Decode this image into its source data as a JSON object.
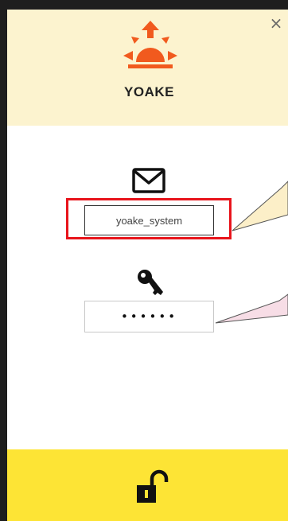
{
  "app": {
    "name": "YOAKE",
    "logo_icon": "sunrise-icon",
    "brand_color": "#f15a1e"
  },
  "window": {
    "close_label": "×"
  },
  "login": {
    "email_icon": "mail-icon",
    "username_value": "yoake_system",
    "password_icon": "key-icon",
    "password_value": "••••••",
    "unlock_icon": "unlock-icon"
  },
  "colors": {
    "header_bg": "#fcf3cf",
    "footer_bg": "#fde435",
    "highlight": "#e8141b",
    "callout_top": "#fcefc8",
    "callout_bottom": "#f7dde6"
  }
}
